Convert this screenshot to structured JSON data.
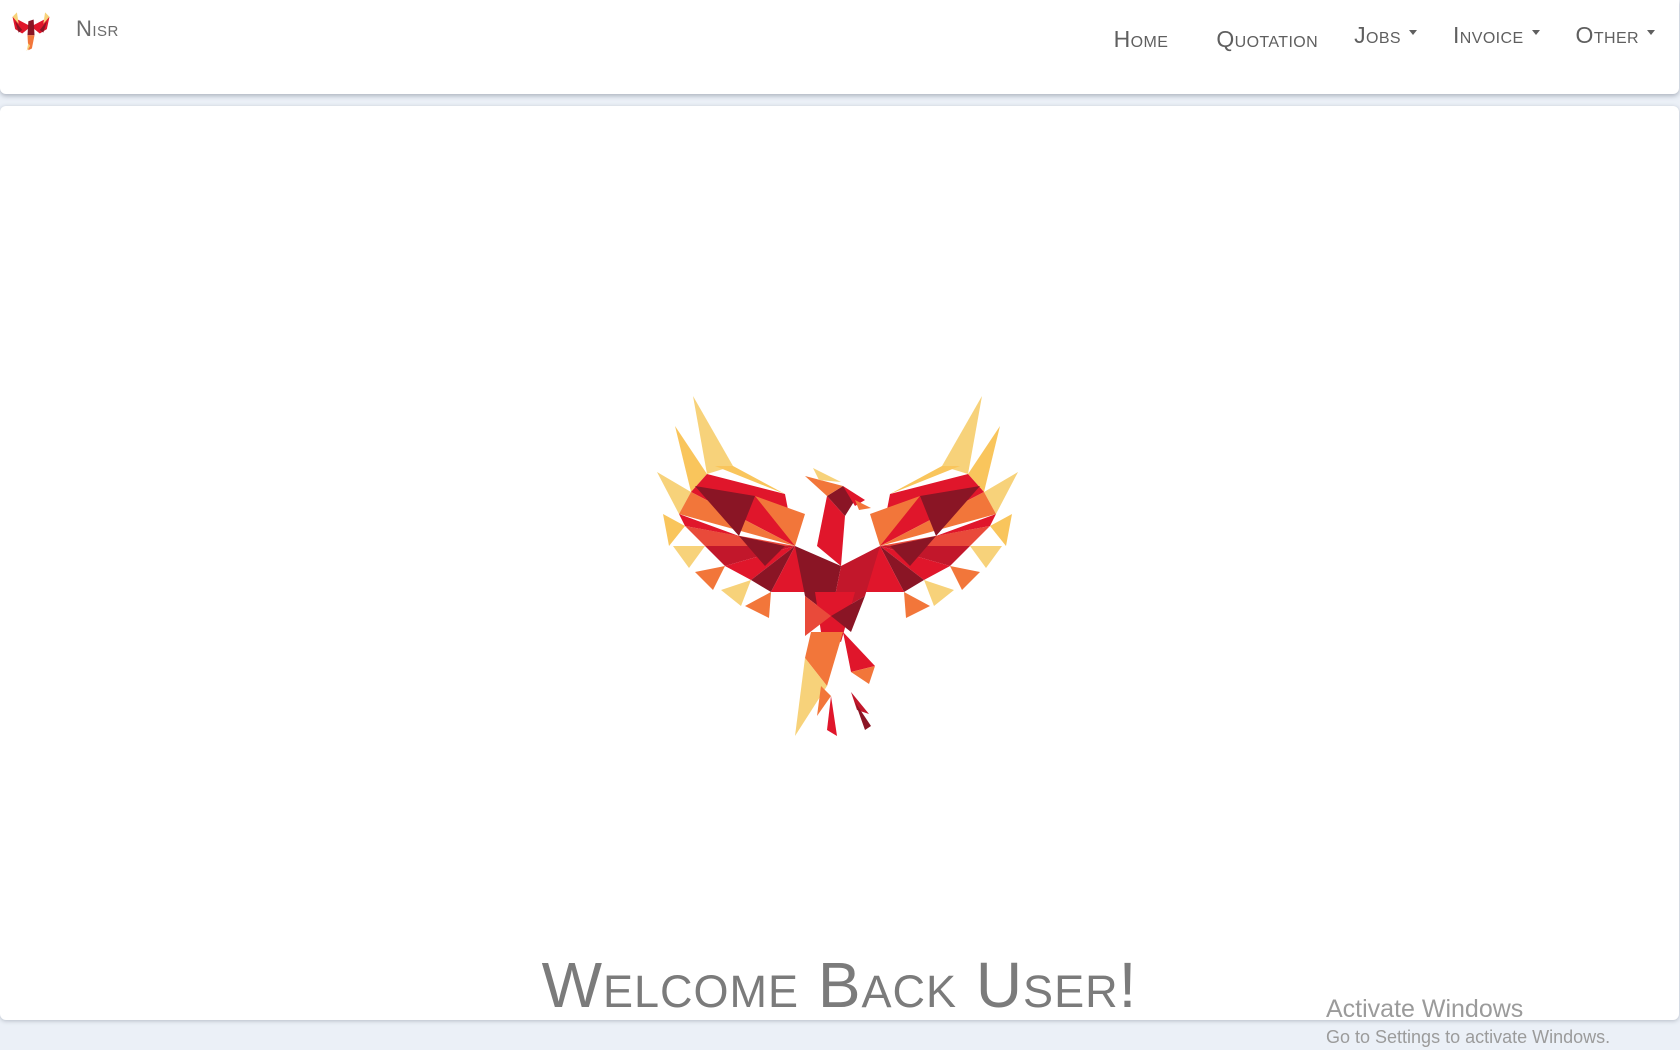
{
  "brand": {
    "name": "Nisr",
    "logo_icon": "phoenix-logo-icon"
  },
  "nav": {
    "items": [
      {
        "label": "Home",
        "dropdown": false
      },
      {
        "label": "Quotation",
        "dropdown": false
      },
      {
        "label": "Jobs",
        "dropdown": true
      },
      {
        "label": "Invoice",
        "dropdown": true
      },
      {
        "label": "Other",
        "dropdown": true
      }
    ]
  },
  "hero": {
    "image_icon": "phoenix-logo-icon",
    "welcome_text": "Welcome Back User!"
  },
  "watermark": {
    "title": "Activate Windows",
    "subtitle": "Go to Settings to activate Windows."
  },
  "colors": {
    "page_background": "#ebf0f7",
    "text_gray": "#5f5f5f",
    "phoenix_dark_red": "#8a1525",
    "phoenix_red": "#e0162b",
    "phoenix_orange": "#f2763a",
    "phoenix_yellow": "#f7d27a"
  }
}
